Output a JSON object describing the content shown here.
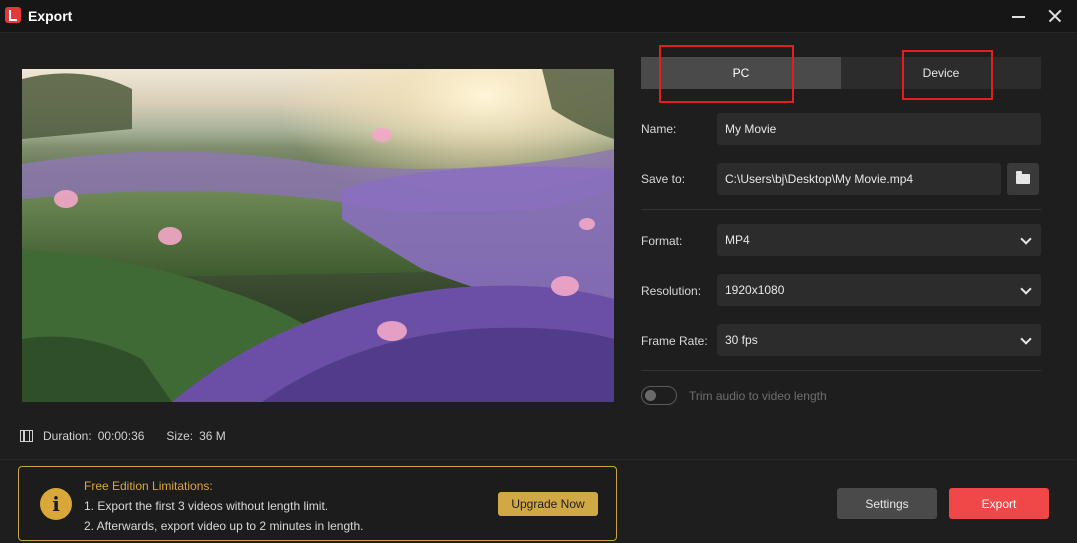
{
  "window": {
    "title": "Export",
    "icons": {
      "app": "app-logo-icon",
      "minimize": "minimize-icon",
      "close": "close-icon"
    }
  },
  "preview": {
    "description_icon": "film-icon",
    "duration_label": "Duration:",
    "duration_value": "00:00:36",
    "size_label": "Size:",
    "size_value": "36 M"
  },
  "tabs": [
    {
      "label": "PC",
      "active": true
    },
    {
      "label": "Device",
      "active": false
    }
  ],
  "form": {
    "name_label": "Name:",
    "name_value": "My Movie",
    "save_label": "Save to:",
    "save_value": "C:\\Users\\bj\\Desktop\\My Movie.mp4",
    "folder_icon": "folder-icon",
    "format_label": "Format:",
    "format_value": "MP4",
    "resolution_label": "Resolution:",
    "resolution_value": "1920x1080",
    "framerate_label": "Frame Rate:",
    "framerate_value": "30 fps",
    "trim_label": "Trim audio to video length",
    "trim_enabled": false
  },
  "notice": {
    "icon": "info-icon",
    "icon_glyph": "i",
    "title": "Free Edition Limitations:",
    "line1": "1. Export the first 3 videos without length limit.",
    "line2": "2. Afterwards, export video up to 2 minutes in length.",
    "upgrade_label": "Upgrade Now"
  },
  "actions": {
    "settings_label": "Settings",
    "export_label": "Export"
  },
  "colors": {
    "background": "#1e1e1e",
    "accent_export": "#f04848",
    "notice_gold": "#d9a838",
    "annotation_red": "#e02020"
  }
}
